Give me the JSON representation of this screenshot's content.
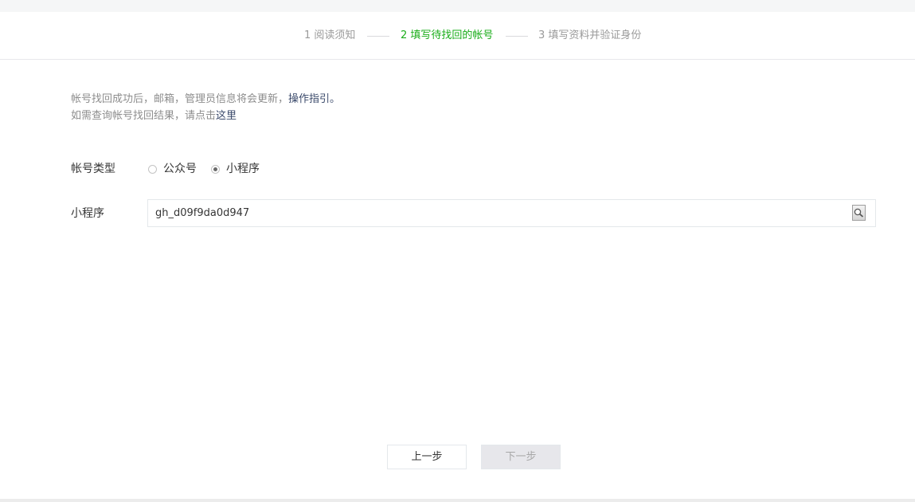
{
  "steps": [
    {
      "label": "1 阅读须知",
      "state": "done"
    },
    {
      "label": "2 填写待找回的帐号",
      "state": "active"
    },
    {
      "label": "3 填写资料并验证身份",
      "state": "pending"
    }
  ],
  "notice": {
    "line1_text": "帐号找回成功后，邮箱，管理员信息将会更新，",
    "line1_link": "操作指引。",
    "line2_text": "如需查询帐号找回结果，请点击",
    "line2_link": "这里"
  },
  "form": {
    "account_type_label": "帐号类型",
    "options": [
      {
        "label": "公众号",
        "checked": false
      },
      {
        "label": "小程序",
        "checked": true
      }
    ],
    "miniprogram_label": "小程序",
    "miniprogram_value": "gh_d09f9da0d947"
  },
  "buttons": {
    "prev": "上一步",
    "next": "下一步"
  },
  "colors": {
    "active_step": "#1aad19",
    "link": "#3b4a6b",
    "disabled_button_bg": "#e7e7eb"
  },
  "icons": {
    "search": "search-icon"
  }
}
